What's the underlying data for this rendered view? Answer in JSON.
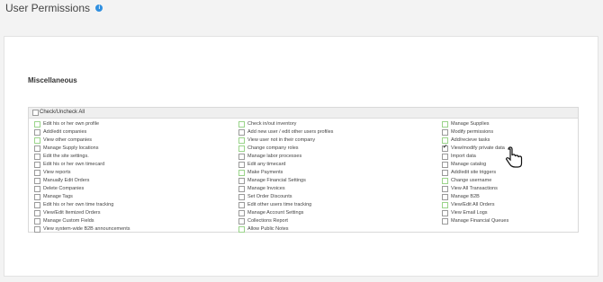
{
  "page": {
    "title": "User Permissions",
    "info_icon": "info-icon"
  },
  "section": {
    "title": "Miscellaneous"
  },
  "check_all": {
    "label": "Check/Uncheck All",
    "checked": false
  },
  "columns": [
    [
      {
        "label": "Edit his or her own profile",
        "checked": false,
        "highlight": true
      },
      {
        "label": "Add/edit companies",
        "checked": false,
        "highlight": false
      },
      {
        "label": "View other companies",
        "checked": false,
        "highlight": true
      },
      {
        "label": "Manage Supply locations",
        "checked": false,
        "highlight": false
      },
      {
        "label": "Edit the site settings.",
        "checked": false,
        "highlight": false
      },
      {
        "label": "Edit his or her own timecard",
        "checked": false,
        "highlight": false
      },
      {
        "label": "View reports",
        "checked": false,
        "highlight": false
      },
      {
        "label": "Manually Edit Orders",
        "checked": false,
        "highlight": false
      },
      {
        "label": "Delete Companies",
        "checked": false,
        "highlight": false
      },
      {
        "label": "Manage Tags",
        "checked": false,
        "highlight": false
      },
      {
        "label": "Edit his or her own time tracking",
        "checked": false,
        "highlight": false
      },
      {
        "label": "View/Edit Itemized Orders",
        "checked": false,
        "highlight": false
      },
      {
        "label": "Manage Custom Fields",
        "checked": false,
        "highlight": false
      },
      {
        "label": "View system-wide B2B announcements",
        "checked": false,
        "highlight": false
      }
    ],
    [
      {
        "label": "Check in/out inventory",
        "checked": false,
        "highlight": true
      },
      {
        "label": "Add new user / edit other users profiles",
        "checked": false,
        "highlight": false
      },
      {
        "label": "View user not in their company",
        "checked": false,
        "highlight": true
      },
      {
        "label": "Change company roles",
        "checked": false,
        "highlight": true
      },
      {
        "label": "Manage labor processes",
        "checked": false,
        "highlight": false
      },
      {
        "label": "Edit any timecard",
        "checked": false,
        "highlight": false
      },
      {
        "label": "Make Payments",
        "checked": false,
        "highlight": true
      },
      {
        "label": "Manage Financial Settings",
        "checked": false,
        "highlight": false
      },
      {
        "label": "Manage Invoices",
        "checked": false,
        "highlight": false
      },
      {
        "label": "Set Order Discounts",
        "checked": false,
        "highlight": false
      },
      {
        "label": "Edit other users time tracking",
        "checked": false,
        "highlight": false
      },
      {
        "label": "Manage Account Settings",
        "checked": false,
        "highlight": false
      },
      {
        "label": "Collections Report",
        "checked": false,
        "highlight": false
      },
      {
        "label": "Allow Public Notes",
        "checked": false,
        "highlight": true
      }
    ],
    [
      {
        "label": "Manage Supplies",
        "checked": false,
        "highlight": true
      },
      {
        "label": "Modify permissions",
        "checked": false,
        "highlight": false
      },
      {
        "label": "Add/recieve tasks",
        "checked": false,
        "highlight": true
      },
      {
        "label": "View/modify private data",
        "checked": true,
        "highlight": false
      },
      {
        "label": "Import data",
        "checked": false,
        "highlight": false
      },
      {
        "label": "Manage catalog",
        "checked": false,
        "highlight": false
      },
      {
        "label": "Add/edit site triggers",
        "checked": false,
        "highlight": false
      },
      {
        "label": "Change username",
        "checked": false,
        "highlight": true
      },
      {
        "label": "View All Transactions",
        "checked": false,
        "highlight": false
      },
      {
        "label": "Manage B2B",
        "checked": false,
        "highlight": false
      },
      {
        "label": "View/Edit All Orders",
        "checked": false,
        "highlight": true
      },
      {
        "label": "View Email Logs",
        "checked": false,
        "highlight": false
      },
      {
        "label": "Manage Financial Queues",
        "checked": false,
        "highlight": false
      }
    ]
  ],
  "colors": {
    "accent": "#2f8fe0",
    "highlight_border": "#9ad48a"
  },
  "cursor": "hand-pointer-icon"
}
